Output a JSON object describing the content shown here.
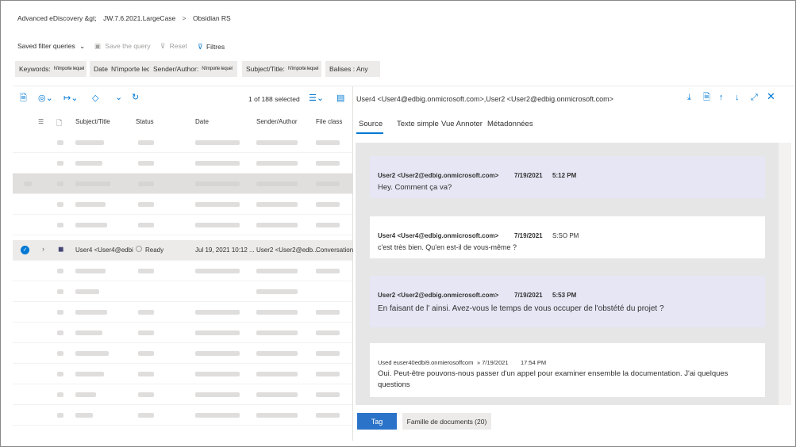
{
  "breadcrumb": {
    "first": "Advanced eDiscovery &gt;",
    "second": "JW.7.6.2021.LargeCase",
    "sep": ">",
    "third": "Obsidian RS"
  },
  "toolbar": {
    "saved": "Saved filter queries",
    "save": "Save the query",
    "reset": "Reset",
    "filters": "Filtres"
  },
  "filters": {
    "keywords_label": "Keywords:",
    "keywords_value": "N'importe lequel",
    "date_label": "Date",
    "date_value": "N'importe lequel",
    "sender_label": "Sender/Author:",
    "sender_value": "N'importe lequel",
    "subject_label": "Subject/Title:",
    "subject_value": "N'importe lequel",
    "tags_label": "Balises : Any"
  },
  "list": {
    "count": "1 of 188 selected",
    "columns": [
      "Subject/Title",
      "Status",
      "Date",
      "Sender/Author",
      "File class"
    ],
    "selected_row": {
      "subject": "User4 <User4@edbi",
      "status": "Ready",
      "date": "Jul 19, 2021 10:12 ...",
      "sender": "User2 <User2@edb...",
      "fileclass": "Conversation"
    }
  },
  "reader": {
    "title": "User4 <User4@edbig.onmicrosoft.com>,User2 <User2@edbig.onmicrosoft.com>",
    "tabs": [
      "Source",
      "Texte simple",
      "Vue Annoter",
      "Métadonnées"
    ],
    "messages": [
      {
        "sender": "User2 <User2@edbig.onmicrosoft.com>",
        "date": "7/19/2021",
        "time": "5:12 PM",
        "text": "Hey. Comment ça va?"
      },
      {
        "sender": "User4 <User4@edbig.onmicrosoft.com>",
        "date": "7/19/2021",
        "time": "S:SO PM",
        "text": "c'est très bien. Qu'en est-il de vous-même ?"
      },
      {
        "sender": "User2 <User2@edbig.onmicrosoft.com>",
        "date": "7/19/2021",
        "time": "5:53 PM",
        "text": "En faisant de l' ainsi. Avez-vous le temps de vous occuper de l'obstété du projet ?"
      },
      {
        "sender": "Used euser40edbi9.onmierosoffcom",
        "date": "» 7/19/2021",
        "time": "17:54 PM",
        "text": "Oui. Peut-être pouvons-nous passer d'un appel pour examiner ensemble la documentation. J'ai quelques",
        "text2": "questions"
      }
    ],
    "tag_button": "Tag",
    "family_button": "Famille de documents (20)"
  },
  "colors": {
    "accent": "#0078d4",
    "purple_msg": "#e6e6f5",
    "pane_bg": "#e6e6e6"
  }
}
